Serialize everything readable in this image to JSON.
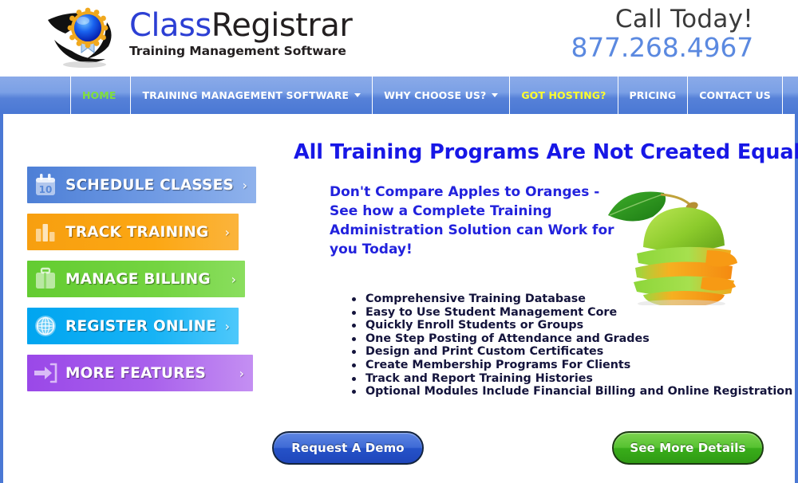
{
  "header": {
    "logo_title_part1": "Class",
    "logo_title_part2": "Registrar",
    "logo_tagline": "Training Management Software",
    "logo_icon": "seal-ribbon-swoosh-logo",
    "call_label": "Call Today!",
    "phone": "877.268.4967",
    "phone_color": "#5b89e0"
  },
  "nav": {
    "items": [
      {
        "label": "HOME",
        "active": true,
        "has_caret": false,
        "color": "#7fe03c"
      },
      {
        "label": "TRAINING MANAGEMENT SOFTWARE",
        "active": false,
        "has_caret": true,
        "color": "#ffffff"
      },
      {
        "label": "WHY CHOOSE US?",
        "active": false,
        "has_caret": true,
        "color": "#ffffff"
      },
      {
        "label": "GOT HOSTING?",
        "active": false,
        "has_caret": false,
        "color": "#ffff2e"
      },
      {
        "label": "PRICING",
        "active": false,
        "has_caret": false,
        "color": "#ffffff"
      },
      {
        "label": "CONTACT US",
        "active": false,
        "has_caret": false,
        "color": "#ffffff"
      }
    ],
    "bar_color": "#5681d8"
  },
  "sidebar": {
    "buttons": [
      {
        "label": "SCHEDULE CLASSES",
        "icon": "calendar-icon",
        "arrow": "›",
        "color": "#4d7fd6"
      },
      {
        "label": "TRACK TRAINING",
        "icon": "bar-chart-icon",
        "arrow": "›",
        "color": "#f79f10"
      },
      {
        "label": "MANAGE BILLING",
        "icon": "briefcase-icon",
        "arrow": "›",
        "color": "#63cc31"
      },
      {
        "label": "REGISTER ONLINE",
        "icon": "globe-icon",
        "arrow": "›",
        "color": "#00a5f0"
      },
      {
        "label": "MORE FEATURES",
        "icon": "arrow-into-door-icon",
        "arrow": "›",
        "color": "#9a48e8"
      }
    ],
    "calendar_day": "10"
  },
  "main": {
    "headline": "All Training Programs Are Not Created Equal",
    "headline_color": "#1717e6",
    "subheadline": "Don't Compare Apples to Oranges - See how a Complete Training Administration Solution can Work for you Today!",
    "hero_image": "sliced-apple-orange-stack",
    "bullets": [
      "Comprehensive Training Database",
      "Easy to Use Student Management Core",
      "Quickly Enroll Students or Groups",
      "One Step Posting of Attendance and Grades",
      "Design and Print Custom Certificates",
      "Create Membership Programs For Clients",
      "Track and Report Training Histories",
      "Optional Modules Include Financial Billing and Online Registration"
    ]
  },
  "cta": {
    "demo_label": "Request A Demo",
    "details_label": "See More Details",
    "demo_color": "#2552c8",
    "details_color": "#39ad1a"
  }
}
